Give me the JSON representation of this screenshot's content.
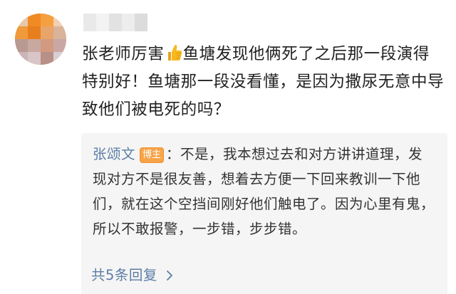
{
  "comment": {
    "text_before_icon": "张老师厉害",
    "icon": "thumbs-up-icon",
    "text_after_icon": "鱼塘发现他俩死了之后那一段演得特别好！鱼塘那一段没看懂，是因为撒尿无意中导致他们被电死的吗？"
  },
  "reply": {
    "author": "张颂文",
    "badge": "博主",
    "separator": "：",
    "text": "不是，我本想过去和对方讲讲道理，发现对方不是很友善，想着去方便一下回来教训一下他们，就在这个空挡间刚好他们触电了。因为心里有鬼，所以不敢报警，一步错，步步错。",
    "view_more_label": "共5条回复"
  },
  "colors": {
    "link_blue": "#5b7da6",
    "badge_orange": "#f6a44a",
    "reply_bg": "#f5f5f5",
    "thumb_yellow": "#f7b81f"
  }
}
